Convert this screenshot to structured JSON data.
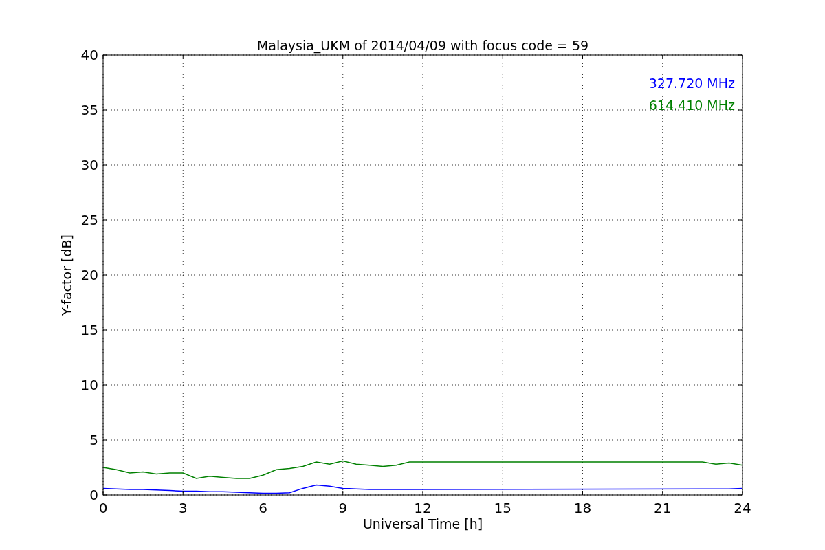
{
  "figure": {
    "chart_data": {
      "type": "line",
      "title": "Malaysia_UKM of 2014/04/09 with focus code = 59",
      "xlabel": "Universal Time [h]",
      "ylabel": "Y-factor [dB]",
      "x": [
        0,
        0.5,
        1,
        1.5,
        2,
        2.5,
        3,
        3.5,
        4,
        4.5,
        5,
        5.5,
        6,
        6.5,
        7,
        7.5,
        8,
        8.5,
        9,
        9.5,
        10,
        10.5,
        11,
        11.5,
        22.5,
        23,
        23.5,
        24
      ],
      "series": [
        {
          "name": "327.720 MHz",
          "color": "#0000ff",
          "values": [
            0.6,
            0.55,
            0.5,
            0.5,
            0.45,
            0.4,
            0.35,
            0.35,
            0.3,
            0.3,
            0.25,
            0.2,
            0.15,
            0.15,
            0.2,
            0.6,
            0.9,
            0.8,
            0.6,
            0.55,
            0.5,
            0.5,
            0.5,
            0.5,
            0.55,
            0.55,
            0.55,
            0.6
          ]
        },
        {
          "name": "614.410 MHz",
          "color": "#008000",
          "values": [
            2.5,
            2.3,
            2.0,
            2.1,
            1.9,
            2.0,
            2.0,
            1.5,
            1.7,
            1.6,
            1.5,
            1.5,
            1.8,
            2.3,
            2.4,
            2.6,
            3.0,
            2.8,
            3.1,
            2.8,
            2.7,
            2.6,
            2.7,
            3.0,
            3.0,
            2.8,
            2.9,
            2.7
          ]
        }
      ],
      "grid": true,
      "xlim": [
        0,
        24
      ],
      "ylim": [
        0,
        40
      ],
      "xticks": [
        0,
        3,
        6,
        9,
        12,
        15,
        18,
        21,
        24
      ],
      "yticks": [
        0,
        5,
        10,
        15,
        20,
        25,
        30,
        35,
        40
      ]
    }
  }
}
